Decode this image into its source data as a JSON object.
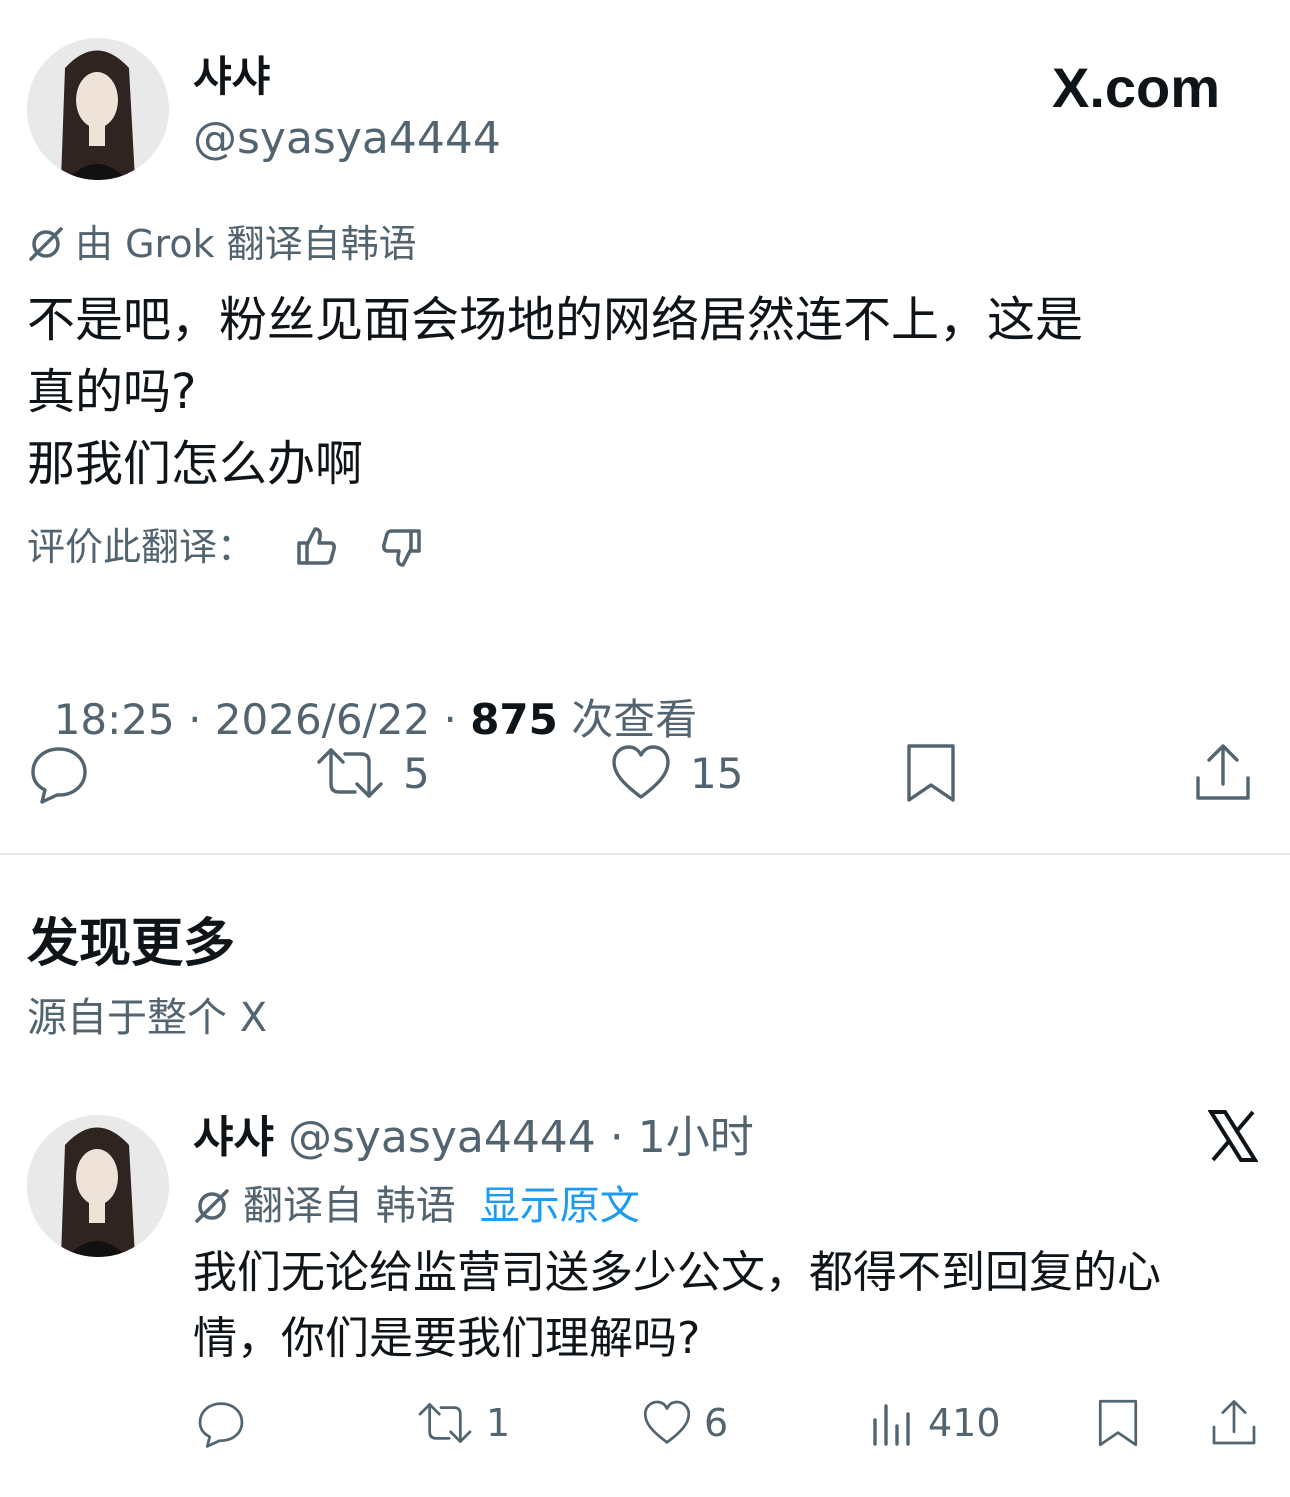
{
  "post": {
    "display_name": "샤샤",
    "handle": "@syasya4444",
    "brand": "X.com",
    "translation_note": "由 Grok 翻译自韩语",
    "body_lines": [
      "不是吧，粉丝见面会场地的网络居然连不上，这是",
      "真的吗?",
      "那我们怎么办啊"
    ],
    "rate_translation_label": "评价此翻译：",
    "meta_time_date": "18:25 · 2026/6/22 · ",
    "views_count": "875",
    "views_label": " 次查看",
    "actions": {
      "reply_count": "",
      "repost_count": "5",
      "like_count": "15"
    }
  },
  "discover": {
    "title": "发现更多",
    "subtitle": "源自于整个 X"
  },
  "reply": {
    "display_name": "샤샤",
    "handle_time": "@syasya4444 · 1小时",
    "translation_prefix": "翻译自 韩语",
    "show_original": "显示原文",
    "body_lines": [
      "我们无论给监营司送多少公文，都得不到回复的心",
      "情，你们是要我们理解吗?"
    ],
    "actions": {
      "repost_count": "1",
      "like_count": "6",
      "views_count": "410"
    }
  },
  "colors": {
    "text": "#0f1419",
    "muted": "#536471",
    "link": "#1d9bf0",
    "divider": "#e6e9ec"
  }
}
